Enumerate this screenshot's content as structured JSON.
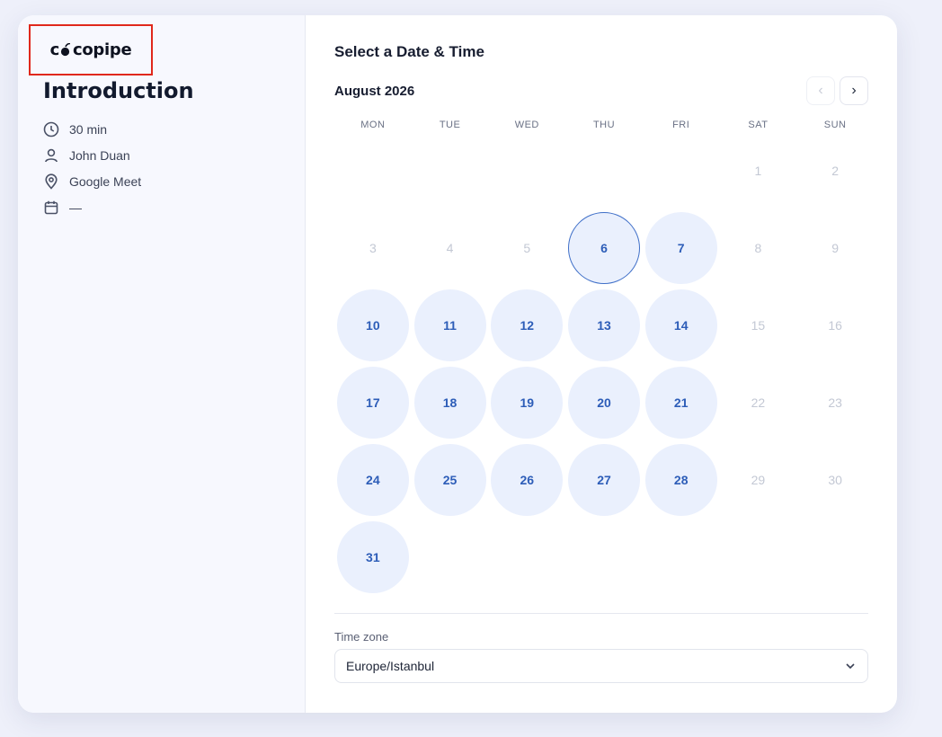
{
  "brand": {
    "logo_text_left": "c",
    "logo_text_right": "copipe"
  },
  "event": {
    "title": "Introduction",
    "duration": "30 min",
    "host": "John Duan",
    "location": "Google Meet",
    "date": "—"
  },
  "scheduler": {
    "heading": "Select a Date & Time",
    "month_label": "August 2026",
    "prev_label": "‹",
    "next_label": "›",
    "weekdays": [
      "MON",
      "TUE",
      "WED",
      "THU",
      "FRI",
      "SAT",
      "SUN"
    ],
    "days": [
      {
        "day": "",
        "state": "empty"
      },
      {
        "day": "",
        "state": "empty"
      },
      {
        "day": "",
        "state": "empty"
      },
      {
        "day": "",
        "state": "empty"
      },
      {
        "day": "",
        "state": "empty"
      },
      {
        "day": "1",
        "state": "disabled"
      },
      {
        "day": "2",
        "state": "disabled"
      },
      {
        "day": "3",
        "state": "disabled"
      },
      {
        "day": "4",
        "state": "disabled"
      },
      {
        "day": "5",
        "state": "disabled"
      },
      {
        "day": "6",
        "state": "selected"
      },
      {
        "day": "7",
        "state": "avail"
      },
      {
        "day": "8",
        "state": "disabled"
      },
      {
        "day": "9",
        "state": "disabled"
      },
      {
        "day": "10",
        "state": "avail"
      },
      {
        "day": "11",
        "state": "avail"
      },
      {
        "day": "12",
        "state": "avail"
      },
      {
        "day": "13",
        "state": "avail"
      },
      {
        "day": "14",
        "state": "avail"
      },
      {
        "day": "15",
        "state": "disabled"
      },
      {
        "day": "16",
        "state": "disabled"
      },
      {
        "day": "17",
        "state": "avail"
      },
      {
        "day": "18",
        "state": "avail"
      },
      {
        "day": "19",
        "state": "avail"
      },
      {
        "day": "20",
        "state": "avail"
      },
      {
        "day": "21",
        "state": "avail"
      },
      {
        "day": "22",
        "state": "disabled"
      },
      {
        "day": "23",
        "state": "disabled"
      },
      {
        "day": "24",
        "state": "avail"
      },
      {
        "day": "25",
        "state": "avail"
      },
      {
        "day": "26",
        "state": "avail"
      },
      {
        "day": "27",
        "state": "avail"
      },
      {
        "day": "28",
        "state": "avail"
      },
      {
        "day": "29",
        "state": "disabled"
      },
      {
        "day": "30",
        "state": "disabled"
      },
      {
        "day": "31",
        "state": "avail"
      }
    ],
    "timezone_label": "Time zone",
    "timezone_value": "Europe/Istanbul"
  },
  "icons": {
    "duration": "clock-icon",
    "host": "user-icon",
    "location": "map-pin-icon",
    "date": "calendar-icon",
    "select": "chevron-down-icon"
  },
  "colors": {
    "accent": "#2d5db8",
    "available_bg": "#eaf0fd",
    "disabled_text": "#c3c8d4",
    "highlight_box": "#e0281c"
  }
}
